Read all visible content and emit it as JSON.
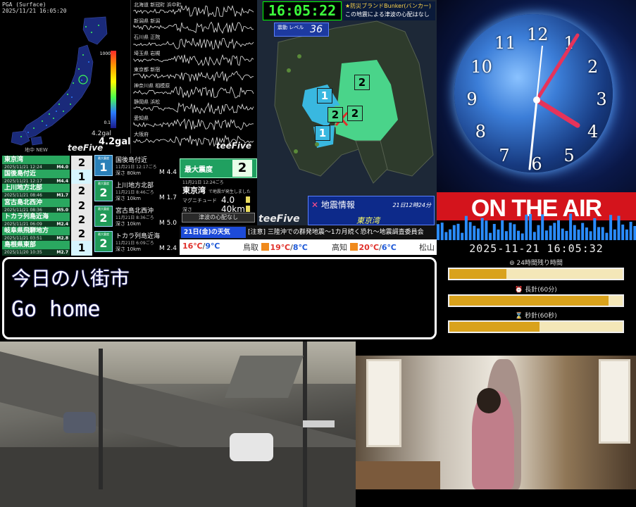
{
  "pga": {
    "title": "PGA (Surface)",
    "datetime": "2025/11/21 16:05:20",
    "scale_top": "1000",
    "scale_bottom": "0.1",
    "value_small": "4.2gal",
    "value_big": "4.2gal",
    "footer": "地中 NEW",
    "brand": "teeFive"
  },
  "seismo": {
    "stations": [
      "北海道 新冠町 浜中町",
      "新潟県 新潟",
      "石川県 正院",
      "埼玉県 岩槻",
      "東京都 新宿",
      "神奈川県 相模原",
      "静岡県 浜松",
      "愛知県",
      "大阪府"
    ],
    "brand": "teeFive"
  },
  "kanto": {
    "clock": "16:05:22",
    "bunker_title": "★防災ブランドBunker(バンカー)",
    "bunker_msg": "この地震による津波の心配はなし",
    "level_label": "震動 レベル",
    "level_value": "36",
    "brand": "teeFive",
    "info_title": "地震情報",
    "info_time": "21日12時24分",
    "info_place": "東京湾",
    "intensity_markers": [
      "1",
      "2",
      "2",
      "2",
      "1"
    ]
  },
  "eq_list": [
    {
      "name": "東京湾",
      "date": "2025/11/21 12:24",
      "mag": "M4.0",
      "int": "2"
    },
    {
      "name": "国後島付近",
      "date": "2025/11/21 12:17",
      "mag": "M4.4",
      "int": "1"
    },
    {
      "name": "上川地方北部",
      "date": "2025/11/21 08:46",
      "mag": "M1.7",
      "int": "2"
    },
    {
      "name": "宮古島北西沖",
      "date": "2025/11/21 08:36",
      "mag": "M5.0",
      "int": "2"
    },
    {
      "name": "トカラ列島近海",
      "date": "2025/11/21 06:09",
      "mag": "M2.4",
      "int": "2"
    },
    {
      "name": "岐阜県飛騨地方",
      "date": "2025/11/21 03:51",
      "mag": "M2.8",
      "int": "2"
    },
    {
      "name": "島根県東部",
      "date": "2025/11/20 10:35",
      "mag": "M2.7",
      "int": "1"
    }
  ],
  "eq_detail": [
    {
      "badge": "1",
      "badge_label": "最大震度",
      "place": "国後島付近",
      "date": "11月21日 12:17ごろ",
      "depth": "深さ 80km",
      "mag": "M 4.4"
    },
    {
      "badge": "2",
      "badge_label": "最大震度",
      "place": "上川地方北部",
      "date": "11月21日 8:46ごろ",
      "depth": "深さ 10km",
      "mag": "M 1.7"
    },
    {
      "badge": "2",
      "badge_label": "最大震度",
      "place": "宮古島北西沖",
      "date": "11月21日 8:36ごろ",
      "depth": "深さ 10km",
      "mag": "M 5.0"
    },
    {
      "badge": "2",
      "badge_label": "最大震度",
      "place": "トカラ列島近海",
      "date": "11月21日 6:09ごろ",
      "depth": "深さ 10km",
      "mag": "M 2.4"
    }
  ],
  "max_intensity": {
    "label": "最大震度",
    "value": "2"
  },
  "quake": {
    "date": "11月21日 12:24ごろ",
    "place": "東京湾",
    "place_note": "で地震が発生しました",
    "mag_label": "マグニチュード",
    "mag_value": "4.0",
    "depth_label": "深さ",
    "depth_value": "40km",
    "tsunami": "津波の心配なし"
  },
  "ticker": {
    "day": "21日(金)の天気",
    "message": "[注意] 三陸沖での群発地震〜1カ月続く恐れ〜地震調査委員会"
  },
  "weather": [
    {
      "city": "",
      "hi": "16℃",
      "lo": "9℃"
    },
    {
      "city": "鳥取",
      "hi": "19℃",
      "lo": "8℃"
    },
    {
      "city": "高知",
      "hi": "20℃",
      "lo": "6℃"
    },
    {
      "city": "松山",
      "hi": "",
      "lo": ""
    }
  ],
  "aclock": {
    "numbers": [
      "12",
      "1",
      "2",
      "3",
      "4",
      "5",
      "6",
      "7",
      "8",
      "9",
      "10",
      "11"
    ]
  },
  "onair": {
    "text": "ON THE AIR"
  },
  "datetime": "2025-11-21 16:05:32",
  "progress": [
    {
      "label": "24時間残り時間",
      "fraction": 0.33
    },
    {
      "label": "長針(60分)",
      "fraction": 0.92
    },
    {
      "label": "秒針(60秒)",
      "fraction": 0.52
    }
  ],
  "message": {
    "line1": "今日の八街市",
    "line2": "Go home"
  },
  "colors": {
    "accent_green": "#2aa860",
    "onair_red": "#d4141c",
    "clock_green": "#3cff3c",
    "bar_fill": "#d9a21c"
  }
}
